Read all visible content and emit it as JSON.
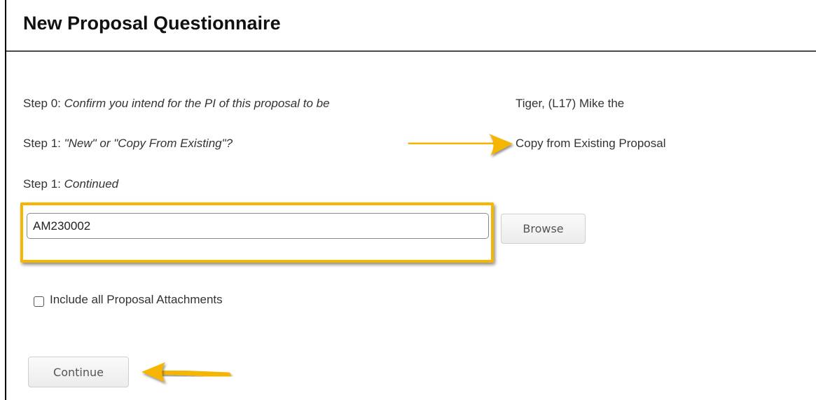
{
  "header": {
    "title": "New Proposal Questionnaire"
  },
  "steps": [
    {
      "prefix": "Step 0: ",
      "question": "Confirm you intend for the PI of this proposal to be",
      "answer": "Tiger, (L17) Mike the"
    },
    {
      "prefix": "Step 1: ",
      "question": "\"New\" or \"Copy From Existing\"?",
      "answer": "Copy from Existing Proposal"
    },
    {
      "prefix": "Step 1: ",
      "question": "Continued"
    }
  ],
  "proposal_field": {
    "value": "AM230002"
  },
  "browse_button": {
    "label": "Browse"
  },
  "attachments_checkbox": {
    "label": "Include all Proposal Attachments",
    "checked": false
  },
  "continue_button": {
    "label": "Continue"
  },
  "colors": {
    "highlight": "#f5b500",
    "text": "#333333"
  },
  "icons": {
    "arrow_to_answer": "arrow-right-icon",
    "arrow_to_continue": "arrow-left-icon"
  }
}
